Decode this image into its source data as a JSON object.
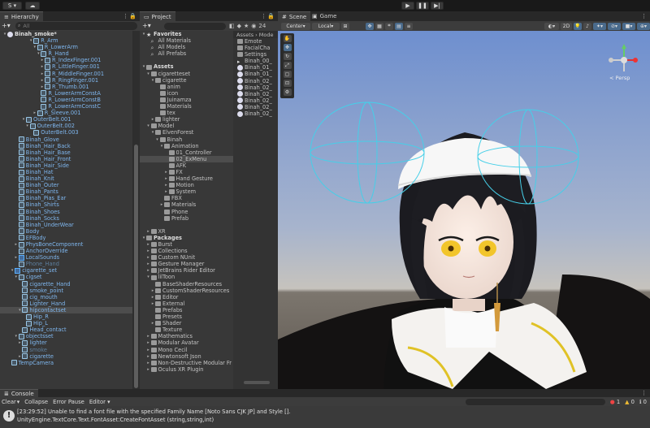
{
  "topbar": {
    "account_label": "S ▾",
    "cloud_icon": "cloud-icon",
    "play_icon": "play-icon",
    "pause_icon": "pause-icon",
    "step_icon": "step-icon"
  },
  "hierarchy": {
    "tab": "Hierarchy",
    "search_placeholder": "All",
    "items": [
      {
        "label": "Binah_smoke*",
        "d": 0,
        "arrow": "▾",
        "icon": "unity",
        "color": "#ddd",
        "bold": true
      },
      {
        "label": "R_Arm",
        "d": 7,
        "arrow": "▾",
        "icon": "cube"
      },
      {
        "label": "R_LowerArm",
        "d": 8,
        "arrow": "▾",
        "icon": "cube"
      },
      {
        "label": "R_Hand",
        "d": 9,
        "arrow": "▾",
        "icon": "cube"
      },
      {
        "label": "R_IndexFinger.001",
        "d": 10,
        "arrow": "▸",
        "icon": "cube"
      },
      {
        "label": "R_LittleFinger.001",
        "d": 10,
        "arrow": "▸",
        "icon": "cube"
      },
      {
        "label": "R_MiddleFinger.001",
        "d": 10,
        "arrow": "▸",
        "icon": "cube"
      },
      {
        "label": "R_RingFinger.001",
        "d": 10,
        "arrow": "▸",
        "icon": "cube"
      },
      {
        "label": "R_Thumb.001",
        "d": 10,
        "arrow": "▸",
        "icon": "cube"
      },
      {
        "label": "R_LowerArmConstA",
        "d": 9,
        "arrow": "",
        "icon": "cube"
      },
      {
        "label": "R_LowerArmConstB",
        "d": 9,
        "arrow": "",
        "icon": "cube"
      },
      {
        "label": "R_LowerArmConstC",
        "d": 9,
        "arrow": "",
        "icon": "cube"
      },
      {
        "label": "R_Sleeve.001",
        "d": 8,
        "arrow": "▸",
        "icon": "cube"
      },
      {
        "label": "OuterBelt.001",
        "d": 5,
        "arrow": "▾",
        "icon": "cube"
      },
      {
        "label": "OuterBelt.002",
        "d": 6,
        "arrow": "▾",
        "icon": "cube"
      },
      {
        "label": "OuterBelt.003",
        "d": 7,
        "arrow": "",
        "icon": "cube"
      },
      {
        "label": "Binah_Glove",
        "d": 3,
        "arrow": "",
        "icon": "cube"
      },
      {
        "label": "Binah_Hair_Back",
        "d": 3,
        "arrow": "",
        "icon": "cube"
      },
      {
        "label": "Binah_Hair_Base",
        "d": 3,
        "arrow": "",
        "icon": "cube"
      },
      {
        "label": "Binah_Hair_Front",
        "d": 3,
        "arrow": "",
        "icon": "cube"
      },
      {
        "label": "Binah_Hair_Side",
        "d": 3,
        "arrow": "",
        "icon": "cube"
      },
      {
        "label": "Binah_Hat",
        "d": 3,
        "arrow": "",
        "icon": "cube"
      },
      {
        "label": "Binah_Knit",
        "d": 3,
        "arrow": "",
        "icon": "cube"
      },
      {
        "label": "Binah_Outer",
        "d": 3,
        "arrow": "",
        "icon": "cube"
      },
      {
        "label": "Binah_Pants",
        "d": 3,
        "arrow": "",
        "icon": "cube"
      },
      {
        "label": "Binah_Pias_Ear",
        "d": 3,
        "arrow": "",
        "icon": "cube"
      },
      {
        "label": "Binah_Shirts",
        "d": 3,
        "arrow": "",
        "icon": "cube"
      },
      {
        "label": "Binah_Shoes",
        "d": 3,
        "arrow": "",
        "icon": "cube"
      },
      {
        "label": "Binah_Socks",
        "d": 3,
        "arrow": "",
        "icon": "cube"
      },
      {
        "label": "Binah_UnderWear",
        "d": 3,
        "arrow": "",
        "icon": "cube"
      },
      {
        "label": "Body",
        "d": 3,
        "arrow": "",
        "icon": "cube"
      },
      {
        "label": "EFBody",
        "d": 3,
        "arrow": "",
        "icon": "cube"
      },
      {
        "label": "PhysBoneComponent",
        "d": 3,
        "arrow": "▸",
        "icon": "cube"
      },
      {
        "label": "AnchorOverride",
        "d": 3,
        "arrow": "",
        "icon": "cube"
      },
      {
        "label": "LocalSounds",
        "d": 3,
        "arrow": "▸",
        "icon": "cube-b"
      },
      {
        "label": "Phone_Hand",
        "d": 3,
        "arrow": "",
        "icon": "cube",
        "dim": true
      },
      {
        "label": "cigarette_set",
        "d": 2,
        "arrow": "▾",
        "icon": "cube-b"
      },
      {
        "label": "cigset",
        "d": 3,
        "arrow": "▾",
        "icon": "cube"
      },
      {
        "label": "cigarette_Hand",
        "d": 4,
        "arrow": "",
        "icon": "cube"
      },
      {
        "label": "smoke_point",
        "d": 4,
        "arrow": "",
        "icon": "cube"
      },
      {
        "label": "cig_mouth",
        "d": 4,
        "arrow": "",
        "icon": "cube"
      },
      {
        "label": "Lighter_Hand",
        "d": 4,
        "arrow": "",
        "icon": "cube"
      },
      {
        "label": "hipcontactset",
        "d": 4,
        "arrow": "▾",
        "icon": "cube",
        "sel": true
      },
      {
        "label": "Hip_R",
        "d": 5,
        "arrow": "",
        "icon": "cube"
      },
      {
        "label": "Hip_L",
        "d": 5,
        "arrow": "",
        "icon": "cube"
      },
      {
        "label": "Head_contact",
        "d": 4,
        "arrow": "",
        "icon": "cube"
      },
      {
        "label": "objectsset",
        "d": 3,
        "arrow": "▾",
        "icon": "cube"
      },
      {
        "label": "lighter",
        "d": 4,
        "arrow": "▸",
        "icon": "cube"
      },
      {
        "label": "smoke",
        "d": 4,
        "arrow": "",
        "icon": "cube",
        "dim": true
      },
      {
        "label": "cigarette",
        "d": 4,
        "arrow": "▸",
        "icon": "cube"
      },
      {
        "label": "TempCamera",
        "d": 1,
        "arrow": "",
        "icon": "cube"
      }
    ]
  },
  "project": {
    "tab": "Project",
    "breadcrumb": [
      "Assets",
      "Mode"
    ],
    "count": "24",
    "items": [
      {
        "label": "Favorites",
        "d": 0,
        "arrow": "▾",
        "icon": "star",
        "bold": true
      },
      {
        "label": "All Materials",
        "d": 1,
        "arrow": "",
        "icon": "search"
      },
      {
        "label": "All Models",
        "d": 1,
        "arrow": "",
        "icon": "search"
      },
      {
        "label": "All Prefabs",
        "d": 1,
        "arrow": "",
        "icon": "search"
      },
      {
        "label": "",
        "d": 0,
        "arrow": "",
        "icon": "none"
      },
      {
        "label": "Assets",
        "d": 0,
        "arrow": "▾",
        "icon": "folder",
        "bold": true
      },
      {
        "label": "cigaretteset",
        "d": 1,
        "arrow": "▾",
        "icon": "folder"
      },
      {
        "label": "cigarette",
        "d": 2,
        "arrow": "▾",
        "icon": "folder"
      },
      {
        "label": "anim",
        "d": 3,
        "arrow": "",
        "icon": "folder"
      },
      {
        "label": "icon",
        "d": 3,
        "arrow": "",
        "icon": "folder"
      },
      {
        "label": "Juinamza",
        "d": 3,
        "arrow": "",
        "icon": "folder"
      },
      {
        "label": "Materials",
        "d": 3,
        "arrow": "",
        "icon": "folder"
      },
      {
        "label": "tex",
        "d": 3,
        "arrow": "",
        "icon": "folder"
      },
      {
        "label": "lighter",
        "d": 2,
        "arrow": "▸",
        "icon": "folder"
      },
      {
        "label": "Model",
        "d": 1,
        "arrow": "▾",
        "icon": "folder"
      },
      {
        "label": "ElvenForest",
        "d": 2,
        "arrow": "▾",
        "icon": "folder"
      },
      {
        "label": "Binah",
        "d": 3,
        "arrow": "▾",
        "icon": "folder"
      },
      {
        "label": "Animation",
        "d": 4,
        "arrow": "▾",
        "icon": "folder"
      },
      {
        "label": "01_Controller",
        "d": 5,
        "arrow": "",
        "icon": "folder"
      },
      {
        "label": "02_ExMenu",
        "d": 5,
        "arrow": "",
        "icon": "folder",
        "sel": true
      },
      {
        "label": "AFK",
        "d": 5,
        "arrow": "",
        "icon": "folder"
      },
      {
        "label": "FX",
        "d": 5,
        "arrow": "▸",
        "icon": "folder"
      },
      {
        "label": "Hand Gesture",
        "d": 5,
        "arrow": "▸",
        "icon": "folder"
      },
      {
        "label": "Motion",
        "d": 5,
        "arrow": "▸",
        "icon": "folder"
      },
      {
        "label": "System",
        "d": 5,
        "arrow": "▸",
        "icon": "folder"
      },
      {
        "label": "FBX",
        "d": 4,
        "arrow": "",
        "icon": "folder"
      },
      {
        "label": "Materials",
        "d": 4,
        "arrow": "▸",
        "icon": "folder"
      },
      {
        "label": "Phone",
        "d": 4,
        "arrow": "",
        "icon": "folder"
      },
      {
        "label": "Prefab",
        "d": 4,
        "arrow": "",
        "icon": "folder"
      },
      {
        "label": "",
        "d": 0,
        "arrow": "",
        "icon": "none"
      },
      {
        "label": "XR",
        "d": 1,
        "arrow": "▸",
        "icon": "folder"
      },
      {
        "label": "Packages",
        "d": 0,
        "arrow": "▾",
        "icon": "folder",
        "bold": true
      },
      {
        "label": "Burst",
        "d": 1,
        "arrow": "▸",
        "icon": "folder"
      },
      {
        "label": "Collections",
        "d": 1,
        "arrow": "▸",
        "icon": "folder"
      },
      {
        "label": "Custom NUnit",
        "d": 1,
        "arrow": "▸",
        "icon": "folder"
      },
      {
        "label": "Gesture Manager",
        "d": 1,
        "arrow": "▸",
        "icon": "folder"
      },
      {
        "label": "JetBrains Rider Editor",
        "d": 1,
        "arrow": "▸",
        "icon": "folder"
      },
      {
        "label": "lilToon",
        "d": 1,
        "arrow": "▾",
        "icon": "folder"
      },
      {
        "label": "BaseShaderResources",
        "d": 2,
        "arrow": "",
        "icon": "folder"
      },
      {
        "label": "CustomShaderResources",
        "d": 2,
        "arrow": "▸",
        "icon": "folder"
      },
      {
        "label": "Editor",
        "d": 2,
        "arrow": "▸",
        "icon": "folder"
      },
      {
        "label": "External",
        "d": 2,
        "arrow": "▸",
        "icon": "folder"
      },
      {
        "label": "Prefabs",
        "d": 2,
        "arrow": "",
        "icon": "folder"
      },
      {
        "label": "Presets",
        "d": 2,
        "arrow": "",
        "icon": "folder"
      },
      {
        "label": "Shader",
        "d": 2,
        "arrow": "▸",
        "icon": "folder"
      },
      {
        "label": "Texture",
        "d": 2,
        "arrow": "",
        "icon": "folder"
      },
      {
        "label": "Mathematics",
        "d": 1,
        "arrow": "▸",
        "icon": "folder"
      },
      {
        "label": "Modular Avatar",
        "d": 1,
        "arrow": "▸",
        "icon": "folder"
      },
      {
        "label": "Mono Cecil",
        "d": 1,
        "arrow": "▸",
        "icon": "folder"
      },
      {
        "label": "Newtonsoft Json",
        "d": 1,
        "arrow": "▸",
        "icon": "folder"
      },
      {
        "label": "Non-Destructive Modular Fr",
        "d": 1,
        "arrow": "▸",
        "icon": "folder"
      },
      {
        "label": "Oculus XR Plugin",
        "d": 1,
        "arrow": "▸",
        "icon": "folder"
      }
    ],
    "files": [
      {
        "label": "Emote",
        "icon": "folder"
      },
      {
        "label": "FacialCha",
        "icon": "folder"
      },
      {
        "label": "Settings",
        "icon": "folder"
      },
      {
        "label": "Binah_00_",
        "icon": "anim"
      },
      {
        "label": "Binah_01_",
        "icon": "unity"
      },
      {
        "label": "Binah_01_",
        "icon": "unity"
      },
      {
        "label": "Binah_02_",
        "icon": "unity"
      },
      {
        "label": "Binah_02_",
        "icon": "unity"
      },
      {
        "label": "Binah_02_",
        "icon": "unity"
      },
      {
        "label": "Binah_02_",
        "icon": "unity"
      },
      {
        "label": "Binah_02_",
        "icon": "unity"
      },
      {
        "label": "Binah_02_",
        "icon": "unity"
      }
    ]
  },
  "scene": {
    "tab_scene": "Scene",
    "tab_game": "Game",
    "pivot": "Center",
    "space": "Local",
    "mode_2d": "2D",
    "view_label": "< Persp"
  },
  "console": {
    "tab": "Console",
    "clear": "Clear",
    "collapse": "Collapse",
    "error_pause": "Error Pause",
    "editor": "Editor",
    "message_line1": "[23:29:52] Unable to find a font file with the specified Family Name [Noto Sans CJK JP] and Style [].",
    "message_line2": "UnityEngine.TextCore.Text.FontAsset:CreateFontAsset (string,string,int)",
    "count_error": "1",
    "count_warn": "0",
    "count_log": "0"
  }
}
